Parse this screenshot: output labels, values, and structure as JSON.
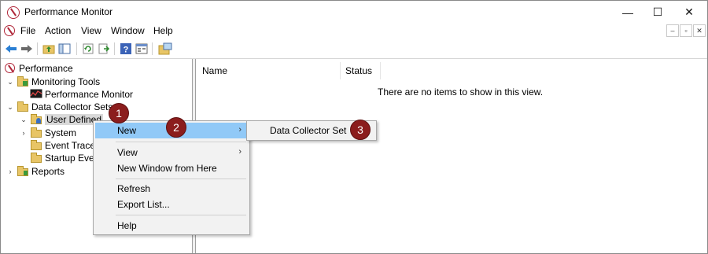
{
  "window": {
    "title": "Performance Monitor",
    "controls": {
      "minimize": "—",
      "maximize": "☐",
      "close": "✕"
    }
  },
  "menubar": {
    "items": [
      "File",
      "Action",
      "View",
      "Window",
      "Help"
    ],
    "mdi_controls": [
      "–",
      "▫",
      "✕"
    ]
  },
  "toolbar": {
    "icons": [
      "back-icon",
      "forward-icon",
      "up-folder-icon",
      "show-hide-tree-icon",
      "refresh-icon",
      "export-icon",
      "help-icon",
      "properties-icon",
      "new-window-icon"
    ]
  },
  "tree": {
    "items": [
      {
        "label": "Performance",
        "icon": "performance-icon",
        "expander": ""
      },
      {
        "label": "Monitoring Tools",
        "icon": "folder-icon",
        "expander": "⌄"
      },
      {
        "label": "Performance Monitor",
        "icon": "perfmon-chart-icon",
        "expander": ""
      },
      {
        "label": "Data Collector Sets",
        "icon": "folder-icon",
        "expander": "⌄"
      },
      {
        "label": "User Defined",
        "icon": "user-folder-icon",
        "expander": "⌄"
      },
      {
        "label": "System",
        "icon": "folder-icon",
        "expander": "›"
      },
      {
        "label": "Event Trace",
        "icon": "folder-icon",
        "expander": ""
      },
      {
        "label": "Startup Ever",
        "icon": "folder-icon",
        "expander": ""
      },
      {
        "label": "Reports",
        "icon": "folder-icon",
        "expander": "›"
      }
    ]
  },
  "list": {
    "columns": [
      "Name",
      "Status"
    ],
    "empty_message": "There are no items to show in this view."
  },
  "context_menu": {
    "new": "New",
    "view": "View",
    "new_window": "New Window from Here",
    "refresh": "Refresh",
    "export_list": "Export List...",
    "help": "Help",
    "arrow": "›"
  },
  "submenu": {
    "data_collector_set": "Data Collector Set"
  },
  "badges": [
    "1",
    "2",
    "3"
  ],
  "colors": {
    "highlight": "#91c9f7",
    "badge": "#8b1d1d",
    "menu_bg": "#f2f2f2"
  }
}
